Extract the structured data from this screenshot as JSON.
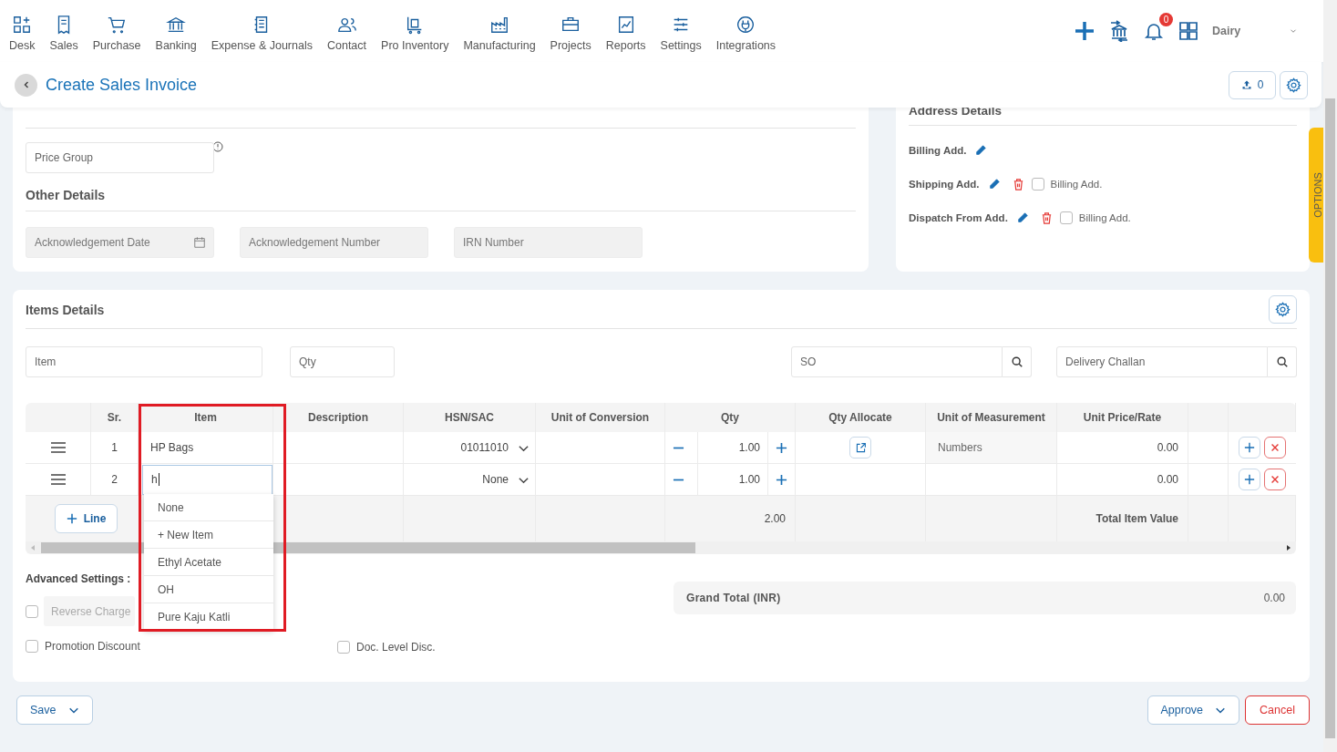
{
  "nav": [
    {
      "label": "Desk"
    },
    {
      "label": "Sales"
    },
    {
      "label": "Purchase"
    },
    {
      "label": "Banking"
    },
    {
      "label": "Expense & Journals"
    },
    {
      "label": "Contact"
    },
    {
      "label": "Pro Inventory"
    },
    {
      "label": "Manufacturing"
    },
    {
      "label": "Projects"
    },
    {
      "label": "Reports"
    },
    {
      "label": "Settings"
    },
    {
      "label": "Integrations"
    }
  ],
  "toolbar": {
    "notification_count": "0",
    "company": "Dairy"
  },
  "page": {
    "title": "Create Sales Invoice",
    "upload_count": "0"
  },
  "price_group": {
    "placeholder": "Price Group",
    "disabled": false
  },
  "other_details": {
    "title": "Other Details",
    "fields": [
      {
        "placeholder": "Acknowledgement Date",
        "kind": "date",
        "disabled": true
      },
      {
        "placeholder": "Acknowledgement Number",
        "kind": "text",
        "disabled": true
      },
      {
        "placeholder": "IRN Number",
        "kind": "text",
        "disabled": true
      }
    ]
  },
  "address": {
    "title": "Address Details",
    "rows": [
      {
        "label": "Billing Add.",
        "deletable": false
      },
      {
        "label": "Shipping Add.",
        "deletable": true,
        "same_as": {
          "label": "Billing Add.",
          "checked": false
        }
      },
      {
        "label": "Dispatch From Add.",
        "deletable": true,
        "same_as": {
          "label": "Billing Add.",
          "checked": false
        }
      }
    ]
  },
  "options_tab": "OPTIONS",
  "items": {
    "title": "Items Details",
    "filters": [
      {
        "placeholder": "Item",
        "kind": "text"
      },
      {
        "placeholder": "Qty",
        "kind": "text"
      },
      {
        "placeholder": "SO",
        "kind": "search"
      },
      {
        "placeholder": "Delivery Challan",
        "kind": "search"
      }
    ],
    "columns": [
      "Sr.",
      "Item",
      "Description",
      "HSN/SAC",
      "Unit of Conversion",
      "Qty",
      "Qty Allocate",
      "Unit of Measurement",
      "Unit Price/Rate"
    ],
    "rows": [
      {
        "sr": "1",
        "item": "HP Bags",
        "editing": false,
        "hsn": "01011010",
        "qty": "1.00",
        "allocate": true,
        "uom": "Numbers",
        "rate": "0.00"
      },
      {
        "sr": "2",
        "item": "h",
        "editing": true,
        "hsn": "None",
        "qty": "1.00",
        "allocate": false,
        "rate": "0.00"
      }
    ],
    "add_line": "Line",
    "qty_total": "2.00",
    "total_label": "Total Item Value",
    "dropdown": [
      "None",
      "+ New Item",
      "Ethyl Acetate",
      "OH",
      "Pure Kaju Katli"
    ]
  },
  "advanced": {
    "title": "Advanced Settings :",
    "reverse_charge": {
      "checked": false,
      "placeholder": "Reverse Charge"
    },
    "options": [
      {
        "label": "Promotion Discount",
        "checked": false
      },
      {
        "label": "Doc. Level Disc.",
        "checked": false
      }
    ]
  },
  "grand_total": {
    "label": "Grand Total (INR)",
    "value": "0.00"
  },
  "footer": {
    "save": "Save",
    "approve": "Approve",
    "cancel": "Cancel"
  }
}
